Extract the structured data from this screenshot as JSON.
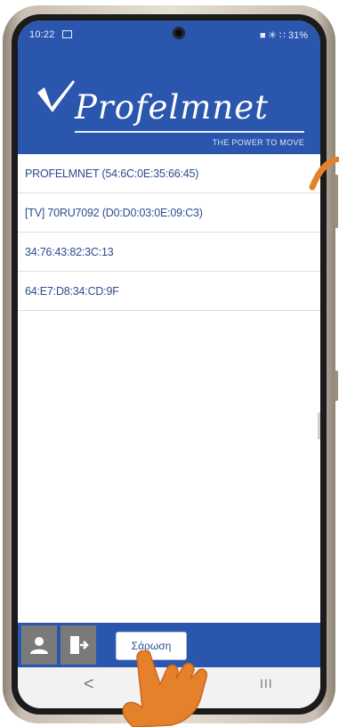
{
  "status_bar": {
    "time": "10:22",
    "right_icons_text": "■ ✳ ∷ 31%"
  },
  "header": {
    "brand": "Profelmnet",
    "tagline": "THE POWER TO MOVE"
  },
  "devices": [
    "PROFELMNET (54:6C:0E:35:66:45)",
    "[TV] 70RU7092 (D0:D0:03:0E:09:C3)",
    "34:76:43:82:3C:13",
    "64:E7:D8:34:CD:9F"
  ],
  "toolbar": {
    "scan_label": "Σάρωση"
  },
  "nav": {
    "back_glyph": "<",
    "recent_glyph": "III"
  },
  "colors": {
    "brand_blue": "#2a56ad",
    "text_blue": "#2b4c8e",
    "accent_orange": "#e6812b"
  },
  "icons": [
    "phone-camera-icon",
    "user-icon",
    "exit-door-icon",
    "brand-logo-icon",
    "pointing-hand-icon",
    "orange-arrow-icon"
  ]
}
